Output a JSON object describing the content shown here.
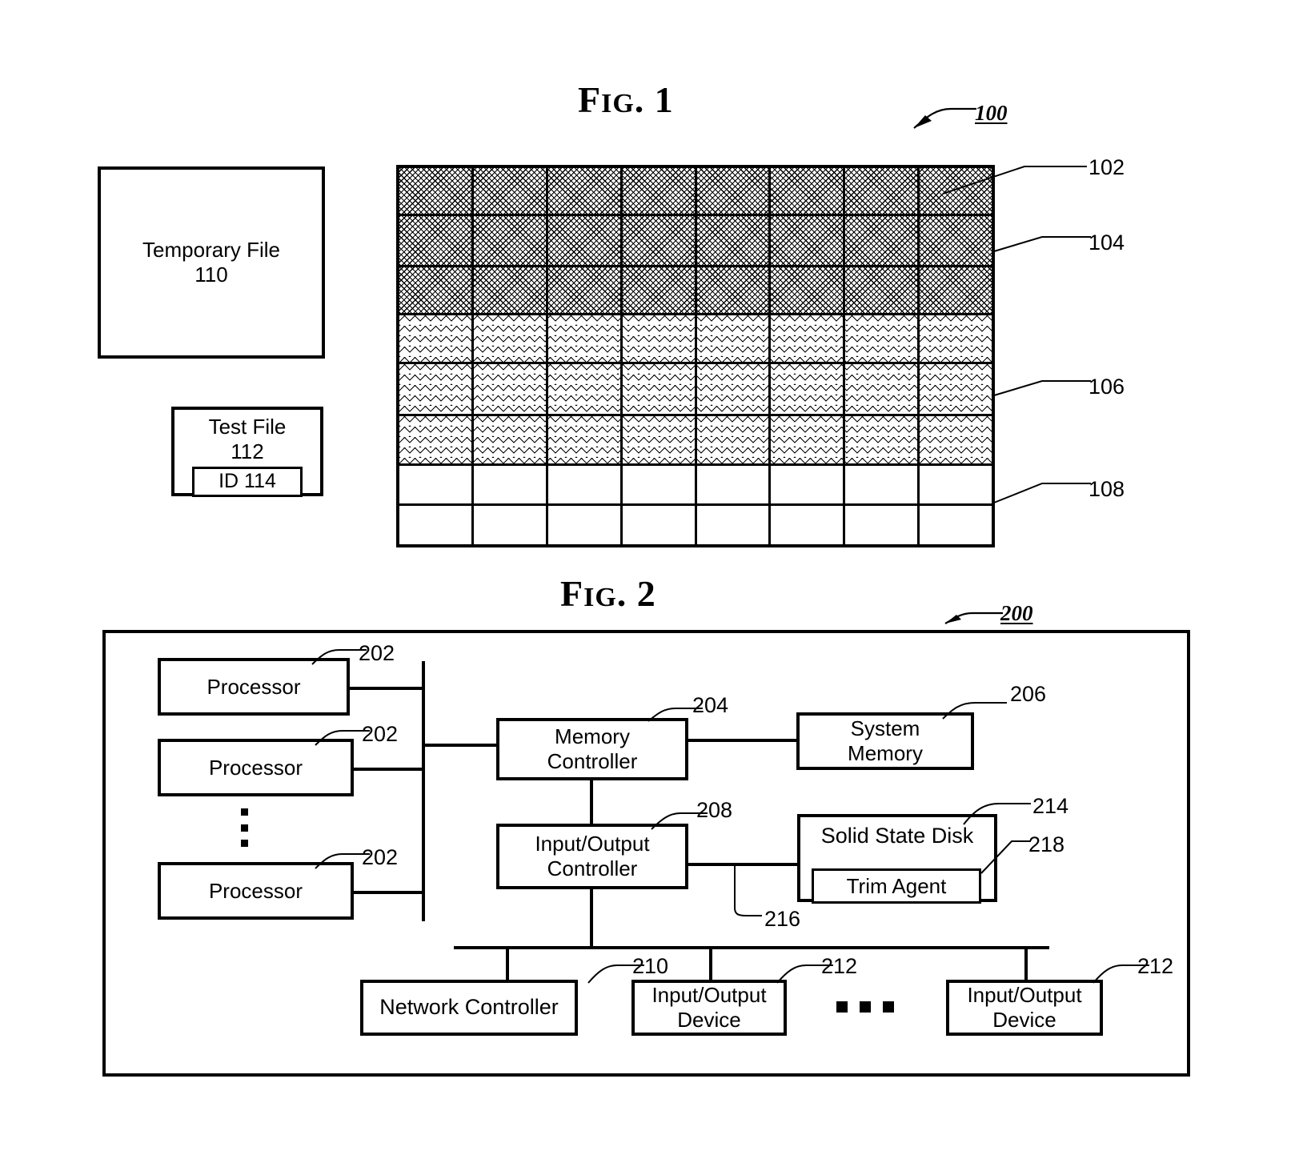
{
  "figures": [
    {
      "caption_first": "F",
      "caption_rest": "IG",
      "caption_dot": ". ",
      "caption_num": "1",
      "number_label": "100"
    },
    {
      "caption_first": "F",
      "caption_rest": "IG",
      "caption_dot": ". ",
      "caption_num": "2",
      "number_label": "200"
    }
  ],
  "fig1": {
    "caption": "FIG. 1",
    "number_label": "100",
    "temporary_file": {
      "line1": "Temporary File",
      "line2": "110"
    },
    "test_file": {
      "line1": "Test File",
      "line2": "112",
      "inner": "ID 114"
    },
    "grid": {
      "columns": 8,
      "rows": [
        {
          "fill": "dense",
          "ref": "102"
        },
        {
          "fill": "dense",
          "ref": ""
        },
        {
          "fill": "dense",
          "ref": "104"
        },
        {
          "fill": "sparse",
          "ref": ""
        },
        {
          "fill": "sparse",
          "ref": "106"
        },
        {
          "fill": "sparse",
          "ref": ""
        },
        {
          "fill": "none",
          "ref": ""
        },
        {
          "fill": "none",
          "ref": "108"
        }
      ]
    },
    "refs": {
      "r102": "102",
      "r104": "104",
      "r106": "106",
      "r108": "108"
    }
  },
  "fig2": {
    "caption": "FIG. 2",
    "number_label": "200",
    "processors": [
      {
        "label": "Processor",
        "ref": "202"
      },
      {
        "label": "Processor",
        "ref": "202"
      },
      {
        "label": "Processor",
        "ref": "202"
      }
    ],
    "memory_controller": {
      "line1": "Memory",
      "line2": "Controller",
      "ref": "204"
    },
    "system_memory": {
      "line1": "System",
      "line2": "Memory",
      "ref": "206"
    },
    "io_controller": {
      "line1": "Input/Output",
      "line2": "Controller",
      "ref": "208"
    },
    "solid_state_disk": {
      "label": "Solid State Disk",
      "ref": "214"
    },
    "trim_agent": {
      "label": "Trim Agent",
      "ref": "218"
    },
    "ssd_link_ref": "216",
    "network_controller": {
      "label": "Network Controller",
      "ref": "210"
    },
    "io_device_left": {
      "line1": "Input/Output",
      "line2": "Device",
      "ref": "212"
    },
    "io_device_right": {
      "line1": "Input/Output",
      "line2": "Device",
      "ref": "212"
    }
  },
  "colors": {
    "ink": "#000000",
    "paper": "#ffffff"
  }
}
